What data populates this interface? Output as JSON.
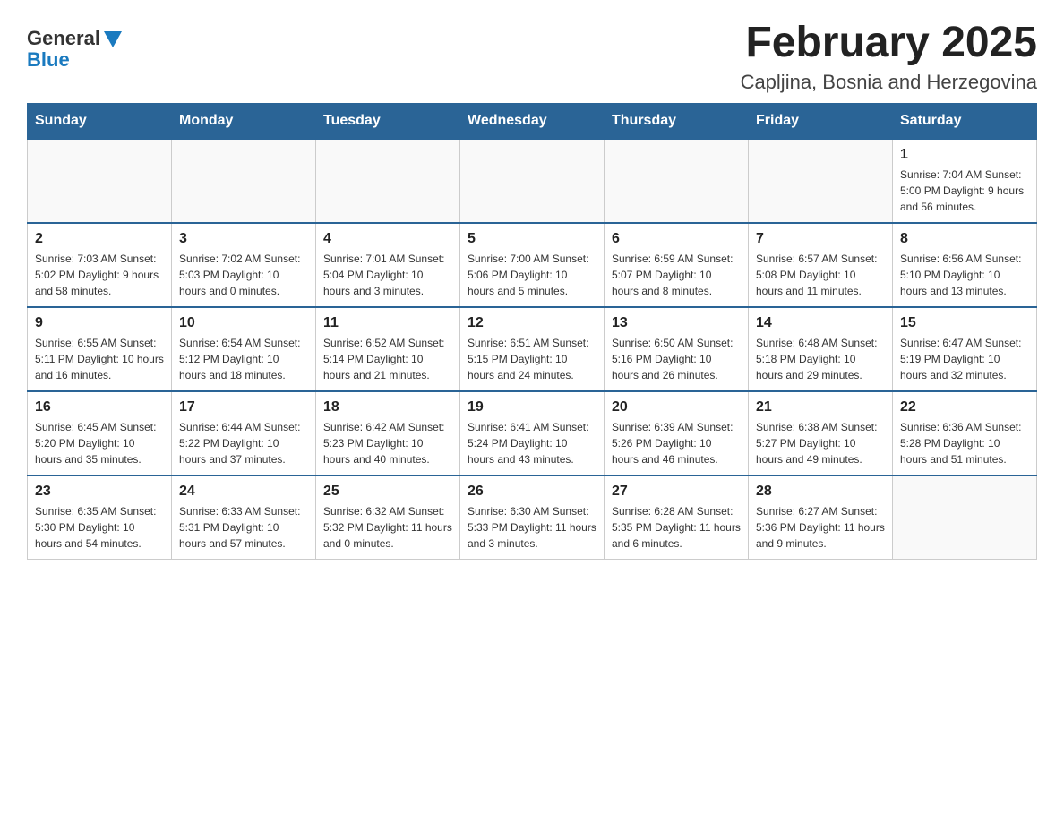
{
  "logo": {
    "general_text": "General",
    "blue_text": "Blue"
  },
  "title": "February 2025",
  "location": "Capljina, Bosnia and Herzegovina",
  "weekdays": [
    "Sunday",
    "Monday",
    "Tuesday",
    "Wednesday",
    "Thursday",
    "Friday",
    "Saturday"
  ],
  "weeks": [
    [
      {
        "day": "",
        "info": ""
      },
      {
        "day": "",
        "info": ""
      },
      {
        "day": "",
        "info": ""
      },
      {
        "day": "",
        "info": ""
      },
      {
        "day": "",
        "info": ""
      },
      {
        "day": "",
        "info": ""
      },
      {
        "day": "1",
        "info": "Sunrise: 7:04 AM\nSunset: 5:00 PM\nDaylight: 9 hours\nand 56 minutes."
      }
    ],
    [
      {
        "day": "2",
        "info": "Sunrise: 7:03 AM\nSunset: 5:02 PM\nDaylight: 9 hours\nand 58 minutes."
      },
      {
        "day": "3",
        "info": "Sunrise: 7:02 AM\nSunset: 5:03 PM\nDaylight: 10 hours\nand 0 minutes."
      },
      {
        "day": "4",
        "info": "Sunrise: 7:01 AM\nSunset: 5:04 PM\nDaylight: 10 hours\nand 3 minutes."
      },
      {
        "day": "5",
        "info": "Sunrise: 7:00 AM\nSunset: 5:06 PM\nDaylight: 10 hours\nand 5 minutes."
      },
      {
        "day": "6",
        "info": "Sunrise: 6:59 AM\nSunset: 5:07 PM\nDaylight: 10 hours\nand 8 minutes."
      },
      {
        "day": "7",
        "info": "Sunrise: 6:57 AM\nSunset: 5:08 PM\nDaylight: 10 hours\nand 11 minutes."
      },
      {
        "day": "8",
        "info": "Sunrise: 6:56 AM\nSunset: 5:10 PM\nDaylight: 10 hours\nand 13 minutes."
      }
    ],
    [
      {
        "day": "9",
        "info": "Sunrise: 6:55 AM\nSunset: 5:11 PM\nDaylight: 10 hours\nand 16 minutes."
      },
      {
        "day": "10",
        "info": "Sunrise: 6:54 AM\nSunset: 5:12 PM\nDaylight: 10 hours\nand 18 minutes."
      },
      {
        "day": "11",
        "info": "Sunrise: 6:52 AM\nSunset: 5:14 PM\nDaylight: 10 hours\nand 21 minutes."
      },
      {
        "day": "12",
        "info": "Sunrise: 6:51 AM\nSunset: 5:15 PM\nDaylight: 10 hours\nand 24 minutes."
      },
      {
        "day": "13",
        "info": "Sunrise: 6:50 AM\nSunset: 5:16 PM\nDaylight: 10 hours\nand 26 minutes."
      },
      {
        "day": "14",
        "info": "Sunrise: 6:48 AM\nSunset: 5:18 PM\nDaylight: 10 hours\nand 29 minutes."
      },
      {
        "day": "15",
        "info": "Sunrise: 6:47 AM\nSunset: 5:19 PM\nDaylight: 10 hours\nand 32 minutes."
      }
    ],
    [
      {
        "day": "16",
        "info": "Sunrise: 6:45 AM\nSunset: 5:20 PM\nDaylight: 10 hours\nand 35 minutes."
      },
      {
        "day": "17",
        "info": "Sunrise: 6:44 AM\nSunset: 5:22 PM\nDaylight: 10 hours\nand 37 minutes."
      },
      {
        "day": "18",
        "info": "Sunrise: 6:42 AM\nSunset: 5:23 PM\nDaylight: 10 hours\nand 40 minutes."
      },
      {
        "day": "19",
        "info": "Sunrise: 6:41 AM\nSunset: 5:24 PM\nDaylight: 10 hours\nand 43 minutes."
      },
      {
        "day": "20",
        "info": "Sunrise: 6:39 AM\nSunset: 5:26 PM\nDaylight: 10 hours\nand 46 minutes."
      },
      {
        "day": "21",
        "info": "Sunrise: 6:38 AM\nSunset: 5:27 PM\nDaylight: 10 hours\nand 49 minutes."
      },
      {
        "day": "22",
        "info": "Sunrise: 6:36 AM\nSunset: 5:28 PM\nDaylight: 10 hours\nand 51 minutes."
      }
    ],
    [
      {
        "day": "23",
        "info": "Sunrise: 6:35 AM\nSunset: 5:30 PM\nDaylight: 10 hours\nand 54 minutes."
      },
      {
        "day": "24",
        "info": "Sunrise: 6:33 AM\nSunset: 5:31 PM\nDaylight: 10 hours\nand 57 minutes."
      },
      {
        "day": "25",
        "info": "Sunrise: 6:32 AM\nSunset: 5:32 PM\nDaylight: 11 hours\nand 0 minutes."
      },
      {
        "day": "26",
        "info": "Sunrise: 6:30 AM\nSunset: 5:33 PM\nDaylight: 11 hours\nand 3 minutes."
      },
      {
        "day": "27",
        "info": "Sunrise: 6:28 AM\nSunset: 5:35 PM\nDaylight: 11 hours\nand 6 minutes."
      },
      {
        "day": "28",
        "info": "Sunrise: 6:27 AM\nSunset: 5:36 PM\nDaylight: 11 hours\nand 9 minutes."
      },
      {
        "day": "",
        "info": ""
      }
    ]
  ]
}
